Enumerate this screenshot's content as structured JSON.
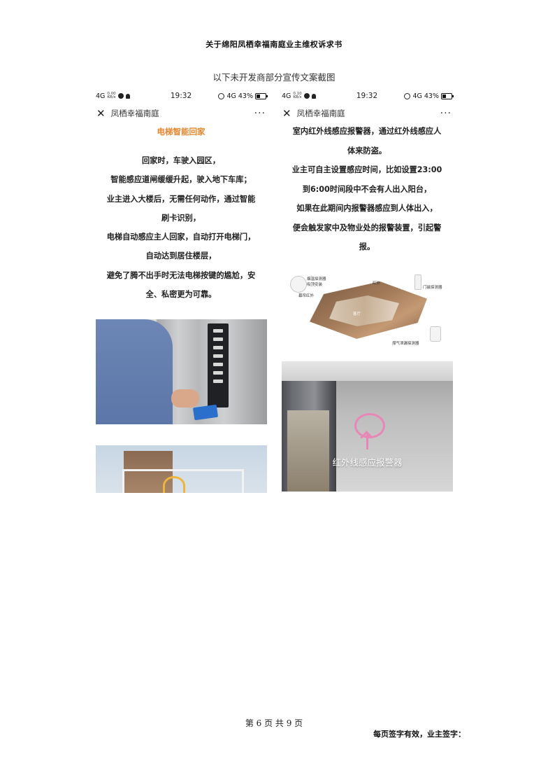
{
  "document": {
    "title": "关于绵阳凤栖幸福南庭业主维权诉求书",
    "caption": "以下未开发商部分宣传文案截图",
    "footer_page": "第 6 页 共 9 页",
    "footer_sign": "每页签字有效，业主签字："
  },
  "screenshots": [
    {
      "status": {
        "network": "4G",
        "speed_value": "0.00",
        "speed_unit": "KB/s",
        "time": "19:32",
        "signal": "4G",
        "battery": "43%"
      },
      "nav": {
        "title": "凤栖幸福南庭",
        "more": "···"
      },
      "heading": "电梯智能回家",
      "lines": [
        "回家时，车驶入园区，",
        "智能感应道闸缓缓升起，驶入地下车库；",
        "业主进入大楼后，无需任何动作，通过智能",
        "刷卡识别，",
        "电梯自动感应主人回家，自动打开电梯门，",
        "自动达到居住楼层，",
        "避免了腾不出手时无法电梯按键的尴尬，安",
        "全、私密更为可靠。"
      ]
    },
    {
      "status": {
        "network": "4G",
        "speed_value": "0.10",
        "speed_unit": "KB/s",
        "time": "19:32",
        "signal": "4G",
        "battery": "43%"
      },
      "nav": {
        "title": "凤栖幸福南庭",
        "more": "···"
      },
      "lines": [
        "室内红外线感应报警器，通过红外线感应人",
        "体来防盗。",
        "业主可自主设置感应时间，比如设置23:00",
        "到6:00时间段中不会有人出入阳台，",
        "如果在此期间内报警器感应到人体出入，",
        "便会触发家中及物业处的报警装置，引起警",
        "报。"
      ],
      "diagram_labels": {
        "smoke": "烟温探测器\n吸顶安装",
        "ir1": "幕帘红外",
        "ir2": "红外",
        "door": "门磁探测器",
        "gas": "煤气泄漏探测器",
        "room": "客厅"
      },
      "photo_caption": "红外线感应报警器"
    }
  ]
}
